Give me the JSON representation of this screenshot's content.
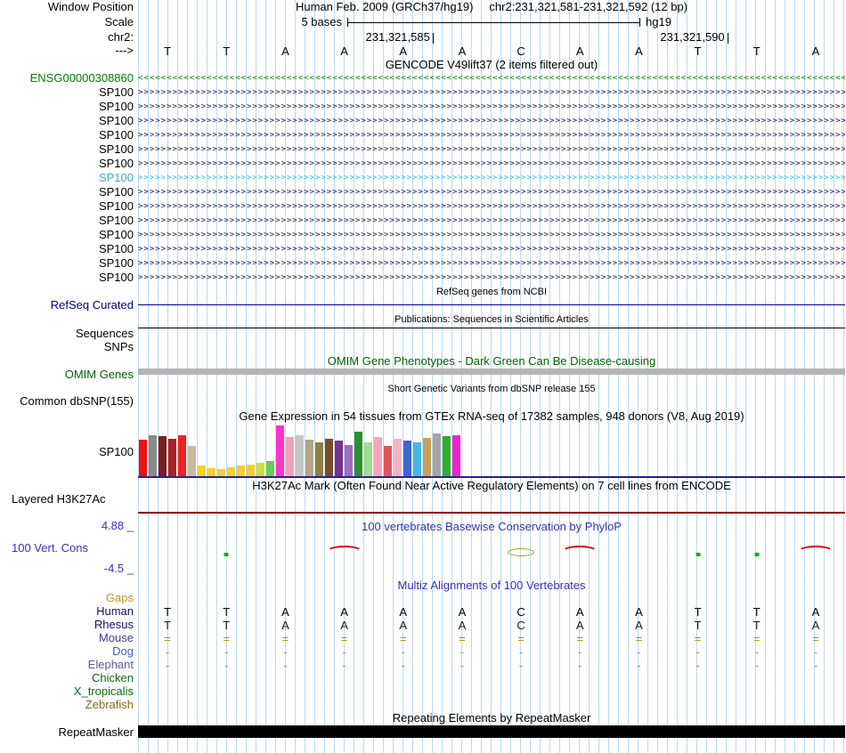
{
  "colors": {
    "guideline_blue": "#78b4dc",
    "track_header_blue": "#3333bb",
    "refseq_navy": "#000080",
    "omim_dark_green": "#006400",
    "omim_bar_gray": "#b4b4b4",
    "h3k27ac_dark_red": "#8b0000",
    "gtex_gene_line": "#2b1d9b",
    "repeatmasker_black": "#000000",
    "gencode_green": "#008000",
    "gencode_cyan": "#3dabc9"
  },
  "ruler": {
    "window_position_label": "Window Position",
    "assembly_text": "Human Feb. 2009 (GRCh37/hg19)",
    "position_text": "chr2:231,321,581-231,321,592 (12 bp)",
    "scale_label": "Scale",
    "scale_value": "5 bases",
    "assembly_short": "hg19",
    "chrom_label": "chr2:",
    "strand_label": "--->",
    "coords": [
      {
        "text": "231,321,585",
        "tick_frac": 0.41667
      },
      {
        "text": "231,321,590",
        "tick_frac": 0.83333
      }
    ],
    "bases": [
      "T",
      "T",
      "A",
      "A",
      "A",
      "A",
      "C",
      "A",
      "A",
      "T",
      "T",
      "A"
    ]
  },
  "gencode": {
    "header": "GENCODE V49lift37 (2 items filtered out)",
    "rows": [
      {
        "label": "ENSG00000308860",
        "direction": "left",
        "label_color": "#008000",
        "arrow_color": "#008000"
      },
      {
        "label": "SP100",
        "direction": "right",
        "label_color": "#000000",
        "arrow_color": "#11114e"
      },
      {
        "label": "SP100",
        "direction": "right",
        "label_color": "#000000",
        "arrow_color": "#11114e"
      },
      {
        "label": "SP100",
        "direction": "right",
        "label_color": "#000000",
        "arrow_color": "#11114e"
      },
      {
        "label": "SP100",
        "direction": "right",
        "label_color": "#000000",
        "arrow_color": "#11114e"
      },
      {
        "label": "SP100",
        "direction": "right",
        "label_color": "#000000",
        "arrow_color": "#11114e"
      },
      {
        "label": "SP100",
        "direction": "right",
        "label_color": "#000000",
        "arrow_color": "#11114e"
      },
      {
        "label": "SP100",
        "direction": "right",
        "label_color": "#3dabc9",
        "arrow_color": "#2fc0d2"
      },
      {
        "label": "SP100",
        "direction": "right",
        "label_color": "#000000",
        "arrow_color": "#11114e"
      },
      {
        "label": "SP100",
        "direction": "right",
        "label_color": "#000000",
        "arrow_color": "#11114e"
      },
      {
        "label": "SP100",
        "direction": "right",
        "label_color": "#000000",
        "arrow_color": "#11114e"
      },
      {
        "label": "SP100",
        "direction": "right",
        "label_color": "#000000",
        "arrow_color": "#11114e"
      },
      {
        "label": "SP100",
        "direction": "right",
        "label_color": "#000000",
        "arrow_color": "#11114e"
      },
      {
        "label": "SP100",
        "direction": "right",
        "label_color": "#000000",
        "arrow_color": "#11114e"
      },
      {
        "label": "SP100",
        "direction": "right",
        "label_color": "#000000",
        "arrow_color": "#11114e"
      }
    ]
  },
  "refseq": {
    "header": "RefSeq genes from NCBI",
    "label": "RefSeq Curated"
  },
  "publications": {
    "header": "Publications: Sequences in Scientific Articles",
    "sequences_label": "Sequences",
    "snps_label": "SNPs"
  },
  "omim": {
    "header": "OMIM Gene Phenotypes - Dark Green Can Be Disease-causing",
    "label": "OMIM Genes"
  },
  "dbsnp": {
    "header": "Short Genetic Variants from dbSNP release 155",
    "label": "Common dbSNP(155)"
  },
  "gtex": {
    "header": "Gene Expression in 54 tissues from GTEx RNA-seq of 17382 samples, 948 donors (V8, Aug 2019)",
    "label": "SP100"
  },
  "chart_data": {
    "type": "bar",
    "title": "Gene Expression in 54 tissues from GTEx RNA-seq of 17382 samples, 948 donors (V8, Aug 2019)",
    "gene": "SP100",
    "note": "bar heights are approximate pixel heights read from the screenshot; no numeric axis is shown; colors follow the GTEx tissue palette",
    "values": [
      41,
      46,
      45,
      42,
      46,
      34,
      12,
      9,
      8,
      10,
      12,
      13,
      15,
      17,
      57,
      44,
      46,
      41,
      38,
      42,
      40,
      35,
      50,
      38,
      44,
      34,
      42,
      40,
      38,
      43,
      48,
      45,
      46
    ],
    "colors": [
      "#ee1111",
      "#8a8a8a",
      "#7a1f1f",
      "#aa2222",
      "#ee2222",
      "#c9b9a0",
      "#f2d12e",
      "#f2d12e",
      "#f2d12e",
      "#f2d12e",
      "#f2d12e",
      "#f2d12e",
      "#cbdd44",
      "#66cc55",
      "#ff33cc",
      "#f2a0bd",
      "#c6c6c6",
      "#b5a586",
      "#8f7f3f",
      "#7a4a2a",
      "#7c2f8e",
      "#a06cc4",
      "#2f8f2f",
      "#9ede8e",
      "#f2a6b8",
      "#e05555",
      "#f0b5c8",
      "#3b66d0",
      "#46b7e6",
      "#c9a055",
      "#a5a5a5",
      "#2fae2f",
      "#ee22cc"
    ],
    "xlabel": "",
    "ylabel": ""
  },
  "h3k27ac": {
    "header": "H3K27Ac Mark (Often Found Near Active Regulatory Elements) on 7 cell lines from ENCODE",
    "label": "Layered H3K27Ac"
  },
  "conservation": {
    "header": "100 vertebrates Basewise Conservation by PhyloP",
    "label": "100 Vert. Cons",
    "max_label": "4.88 _",
    "min_label": "-4.5 _",
    "glyphs": [
      {
        "base": 1,
        "type": "square"
      },
      {
        "base": 3,
        "type": "arc"
      },
      {
        "base": 6,
        "type": "ellipse"
      },
      {
        "base": 7,
        "type": "arc"
      },
      {
        "base": 9,
        "type": "square"
      },
      {
        "base": 10,
        "type": "square"
      },
      {
        "base": 11,
        "type": "arc"
      }
    ]
  },
  "multiz": {
    "header": "Multiz Alignments of 100 Vertebrates",
    "rows": [
      {
        "label": "Gaps",
        "color": "#c9932b",
        "cells": [],
        "cell_color": "#c9932b"
      },
      {
        "label": "Human",
        "color": "#10106a",
        "cells": [
          "T",
          "T",
          "A",
          "A",
          "A",
          "A",
          "C",
          "A",
          "A",
          "T",
          "T",
          "A"
        ],
        "cell_color": "#000000"
      },
      {
        "label": "Rhesus",
        "color": "#10106a",
        "cells": [
          "T",
          "T",
          "A",
          "A",
          "A",
          "A",
          "C",
          "A",
          "A",
          "T",
          "T",
          "A"
        ],
        "cell_color": "#1a1a1a"
      },
      {
        "label": "Mouse",
        "color": "#3c3c9e",
        "cells": [
          "=",
          "=",
          "=",
          "=",
          "=",
          "=",
          "=",
          "=",
          "=",
          "=",
          "=",
          "="
        ],
        "cell_color": "#b8860b"
      },
      {
        "label": "Dog",
        "color": "#3a5fc8",
        "cells": [
          "-",
          "-",
          "-",
          "-",
          "-",
          "-",
          "-",
          "-",
          "-",
          "-",
          "-",
          "-"
        ],
        "cell_color": "#9494b0"
      },
      {
        "label": "Elephant",
        "color": "#69559e",
        "cells": [
          "-",
          "-",
          "-",
          "-",
          "-",
          "-",
          "-",
          "-",
          "-",
          "-",
          "-",
          "-"
        ],
        "cell_color": "#b08f4a"
      },
      {
        "label": "Chicken",
        "color": "#0a6e0a",
        "cells": [],
        "cell_color": "#0a6e0a"
      },
      {
        "label": "X_tropicalis",
        "color": "#0a6e0a",
        "cells": [],
        "cell_color": "#0a6e0a"
      },
      {
        "label": "Zebrafish",
        "color": "#7d6a1f",
        "cells": [],
        "cell_color": "#7d6a1f"
      }
    ]
  },
  "repeatmasker": {
    "header": "Repeating Elements by RepeatMasker",
    "label": "RepeatMasker"
  }
}
